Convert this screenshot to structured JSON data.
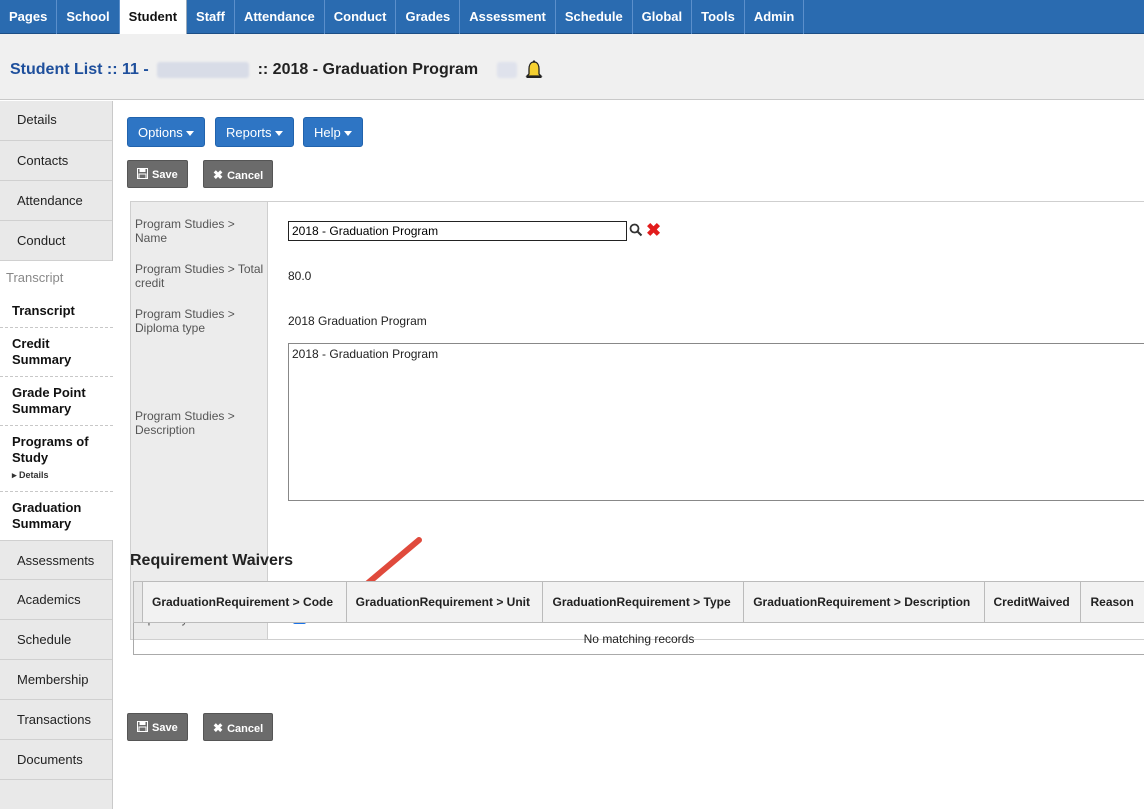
{
  "topnav": {
    "tabs": [
      "Pages",
      "School",
      "Student",
      "Staff",
      "Attendance",
      "Conduct",
      "Grades",
      "Assessment",
      "Schedule",
      "Global",
      "Tools",
      "Admin"
    ]
  },
  "title": {
    "prefix": "Student List :: 11 -",
    "suffix": ":: 2018 - Graduation Program"
  },
  "sidenav": {
    "top_items": [
      "Details",
      "Contacts",
      "Attendance",
      "Conduct"
    ],
    "section_label": "Transcript",
    "sub_items": {
      "transcript": "Transcript",
      "credit_summary": "Credit Summary",
      "gpa_summary": "Grade Point Summary",
      "programs_of_study": "Programs of Study",
      "programs_detail": "▸ Details",
      "graduation_summary": "Graduation Summary"
    },
    "bottom_items": [
      "Assessments",
      "Academics",
      "Schedule",
      "Membership",
      "Transactions",
      "Documents"
    ]
  },
  "toolbar": {
    "options_label": "Options",
    "reports_label": "Reports",
    "help_label": "Help",
    "save_label": "Save",
    "cancel_label": "Cancel"
  },
  "form": {
    "name_label": "Program Studies > Name",
    "name_value": "2018 - Graduation Program",
    "total_credit_label": "Program Studies > Total credit",
    "total_credit_value": "80.0",
    "diploma_type_label": "Program Studies > Diploma type",
    "diploma_type_value": "2018 Graduation Program",
    "description_label": "Program Studies > Description",
    "description_value": "2018 - Graduation Program",
    "is_primary_label": "Is primary?",
    "is_primary_checked": true
  },
  "waivers": {
    "heading": "Requirement Waivers",
    "columns": [
      "GraduationRequirement > Code",
      "GraduationRequirement > Unit",
      "GraduationRequirement > Type",
      "GraduationRequirement > Description",
      "CreditWaived",
      "Reason"
    ],
    "empty_message": "No matching records"
  },
  "colors": {
    "nav_blue": "#2a6bb0",
    "button_blue": "#2e75c4",
    "button_grey": "#6b6b6b",
    "title_blue": "#1e4f9c",
    "clear_red": "#e21c1c",
    "annotation_arrow": "#e04a3c"
  }
}
